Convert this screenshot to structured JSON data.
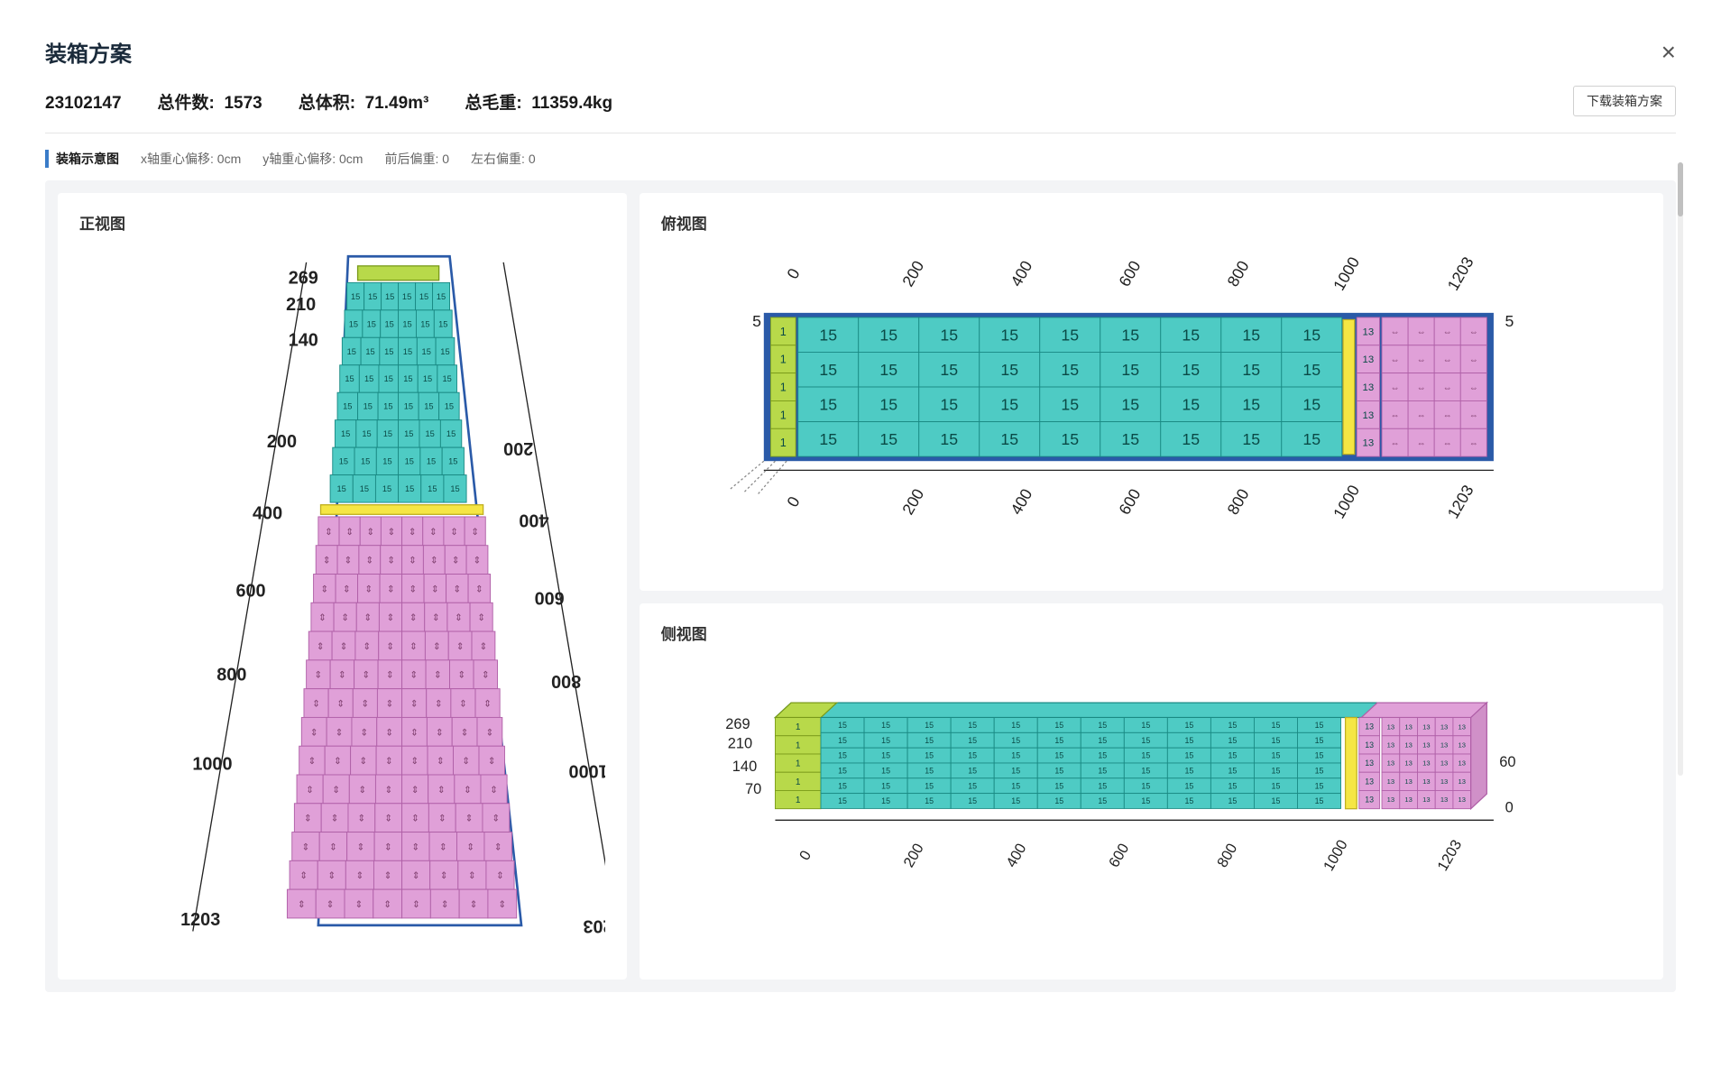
{
  "title": "装箱方案",
  "close_glyph": "×",
  "summary": {
    "id": "23102147",
    "total_pieces_label": "总件数:",
    "total_pieces": "1573",
    "total_volume_label": "总体积:",
    "total_volume": "71.49m³",
    "total_gross_label": "总毛重:",
    "total_gross": "11359.4kg"
  },
  "download_label": "下载装箱方案",
  "info": {
    "section_title": "装箱示意图",
    "x_offset_label": "x轴重心偏移:",
    "x_offset_value": "0cm",
    "y_offset_label": "y轴重心偏移:",
    "y_offset_value": "0cm",
    "fb_label": "前后偏重:",
    "fb_value": "0",
    "lr_label": "左右偏重:",
    "lr_value": "0"
  },
  "panels": {
    "front": "正视图",
    "top": "俯视图",
    "side": "侧视图"
  },
  "axis_ticks_long": [
    "0",
    "200",
    "400",
    "600",
    "800",
    "1000",
    "1203"
  ],
  "axis_ticks_height": [
    "269",
    "210",
    "140",
    "70"
  ],
  "axis_ticks_top_side": [
    "5"
  ],
  "box_labels": {
    "teal": "15",
    "lime": "1",
    "pink_small": "13"
  },
  "colors": {
    "teal": "#4ecbc4",
    "teal_edge": "#1a8a84",
    "lime": "#b8d94a",
    "lime_edge": "#7a9a1a",
    "yellow": "#f5e644",
    "pink": "#e0a0d8",
    "pink_edge": "#b060a8",
    "container": "#2a5aa8",
    "axis": "#222"
  }
}
